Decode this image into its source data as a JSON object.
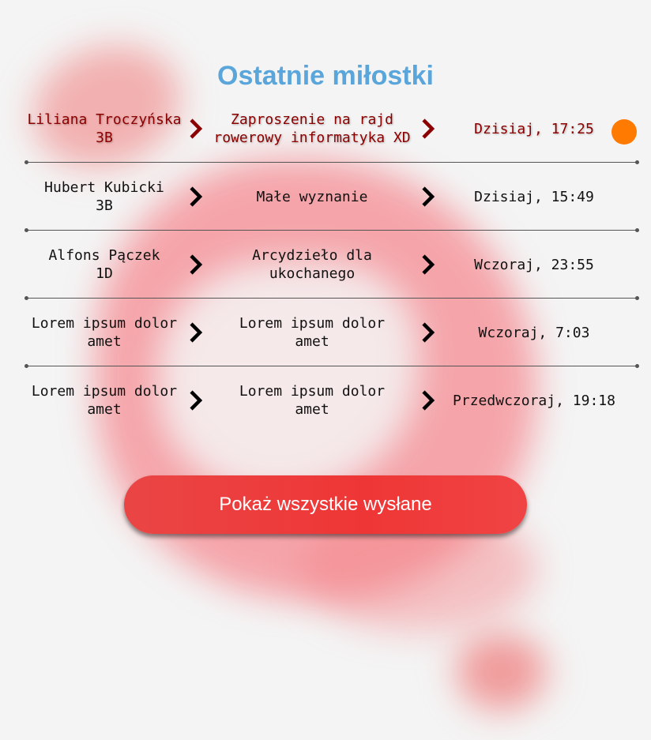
{
  "header": {
    "title": "Ostatnie miłostki"
  },
  "colors": {
    "title": "#5aa6db",
    "unread_text": "#8b0000",
    "unread_indicator": "#ff7a00",
    "button": "#ef3636"
  },
  "rows": [
    {
      "sender_name": "Liliana Troczyńska",
      "sender_class": "3B",
      "message_line1": "Zaproszenie na rajd",
      "message_line2": "rowerowy informatyka XD",
      "time": "Dzisiaj, 17:25",
      "unread": true
    },
    {
      "sender_name": "Hubert Kubicki",
      "sender_class": "3B",
      "message_line1": "Małe wyznanie",
      "message_line2": "",
      "time": "Dzisiaj, 15:49",
      "unread": false
    },
    {
      "sender_name": "Alfons Pączek",
      "sender_class": "1D",
      "message_line1": "Arcydzieło dla",
      "message_line2": "ukochanego",
      "time": "Wczoraj, 23:55",
      "unread": false
    },
    {
      "sender_name": "Lorem ipsum dolor",
      "sender_class": "amet",
      "message_line1": "Lorem ipsum dolor",
      "message_line2": "amet",
      "time": "Wczoraj, 7:03",
      "unread": false
    },
    {
      "sender_name": "Lorem ipsum dolor",
      "sender_class": "amet",
      "message_line1": "Lorem ipsum dolor",
      "message_line2": "amet",
      "time": "Przedwczoraj, 19:18",
      "unread": false
    }
  ],
  "icons": {
    "row_arrow": "chevron-right-icon",
    "unread": "unread-dot-icon"
  },
  "actions": {
    "show_all_label": "Pokaż wszystkie wysłane"
  }
}
